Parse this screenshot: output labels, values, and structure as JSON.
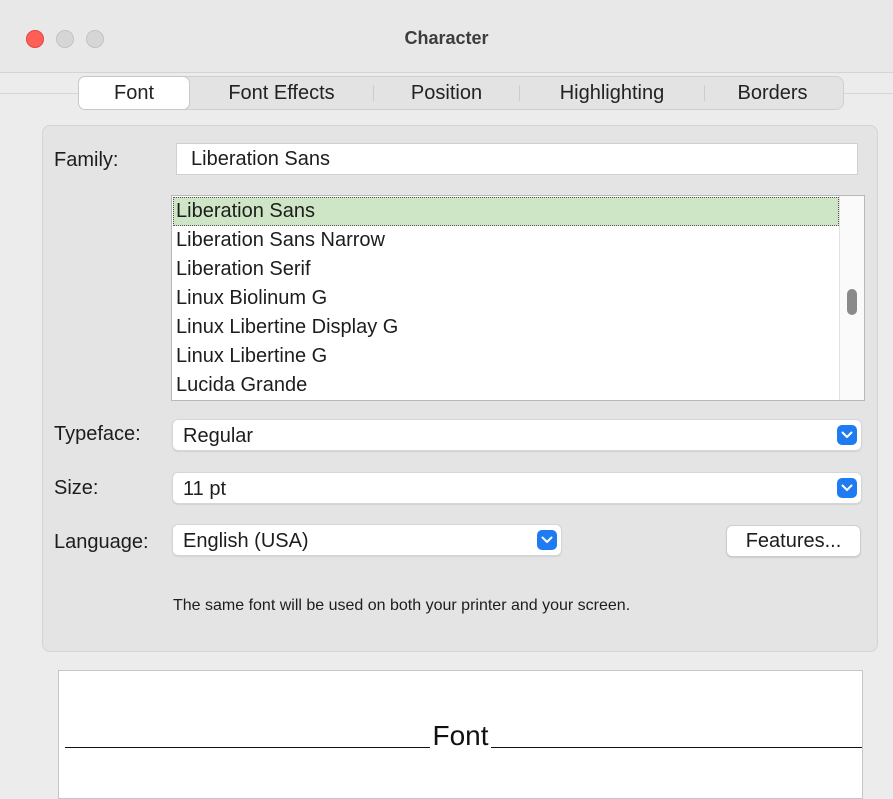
{
  "window": {
    "title": "Character"
  },
  "tabs": [
    {
      "label": "Font",
      "active": true
    },
    {
      "label": "Font Effects",
      "active": false
    },
    {
      "label": "Position",
      "active": false
    },
    {
      "label": "Highlighting",
      "active": false
    },
    {
      "label": "Borders",
      "active": false
    }
  ],
  "family": {
    "label": "Family:",
    "value": "Liberation Sans",
    "list": [
      "Liberation Sans",
      "Liberation Sans Narrow",
      "Liberation Serif",
      "Linux Biolinum G",
      "Linux Libertine Display G",
      "Linux Libertine G",
      "Lucida Grande"
    ],
    "selected_index": 0
  },
  "typeface": {
    "label": "Typeface:",
    "value": "Regular"
  },
  "size": {
    "label": "Size:",
    "value": "11 pt"
  },
  "language": {
    "label": "Language:",
    "value": "English (USA)"
  },
  "features_button": {
    "label": "Features..."
  },
  "note": "The same font will be used on both your printer and your screen.",
  "preview": {
    "text": "Font"
  },
  "colors": {
    "selection": "#cfe6c6",
    "accent": "#1f7bf2",
    "close": "#ff5f57"
  },
  "icons": {
    "dropdown": "chevron-down-icon"
  }
}
